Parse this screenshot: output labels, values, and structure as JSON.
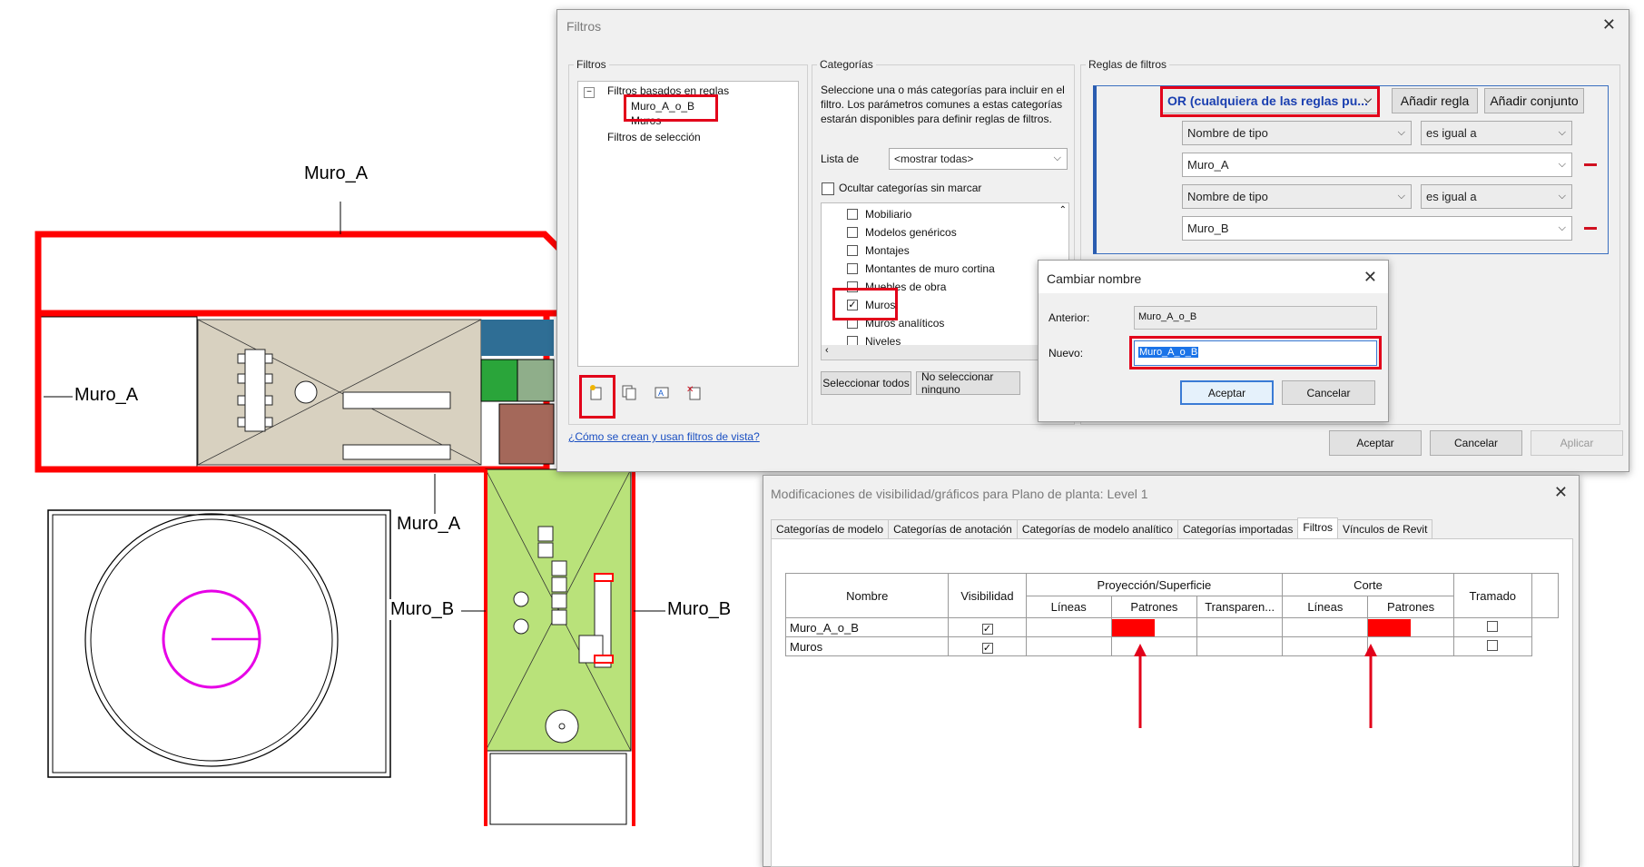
{
  "plan": {
    "labels": [
      "Muro_A",
      "Muro_A",
      "Muro_A",
      "Muro_B",
      "Muro_B"
    ]
  },
  "filtros_dialog": {
    "title": "Filtros",
    "filters_group": "Filtros",
    "tree_rules": "Filtros basados en reglas",
    "tree_item1": "Muro_A_o_B",
    "tree_item2": "Muros",
    "tree_selection": "Filtros de selección",
    "help_link": "¿Cómo se crean y usan filtros de vista?",
    "categories_group": "Categorías",
    "categories_desc": "Seleccione una o más categorías para incluir en el filtro. Los parámetros comunes a estas categorías estarán disponibles para definir reglas de filtros.",
    "list_label": "Lista de",
    "list_value": "<mostrar todas>",
    "hide_unchecked": "Ocultar categorías sin marcar",
    "categories": [
      {
        "name": "Mobiliario",
        "checked": false
      },
      {
        "name": "Modelos genéricos",
        "checked": false
      },
      {
        "name": "Montajes",
        "checked": false
      },
      {
        "name": "Montantes de muro cortina",
        "checked": false
      },
      {
        "name": "Muebles de obra",
        "checked": false
      },
      {
        "name": "Muros",
        "checked": true
      },
      {
        "name": "Muros analíticos",
        "checked": false
      },
      {
        "name": "Niveles",
        "checked": false
      }
    ],
    "select_all": "Seleccionar todos",
    "select_none": "No seleccionar ninguno",
    "rules_group": "Reglas de filtros",
    "rule_op": "OR (cualquiera de las reglas pu...",
    "add_rule": "Añadir regla",
    "add_set": "Añadir conjunto",
    "rules": [
      {
        "param": "Nombre de tipo",
        "cond": "es igual a",
        "value": "Muro_A"
      },
      {
        "param": "Nombre de tipo",
        "cond": "es igual a",
        "value": "Muro_B"
      }
    ],
    "ok": "Aceptar",
    "cancel": "Cancelar",
    "apply": "Aplicar"
  },
  "rename_dialog": {
    "title": "Cambiar nombre",
    "old_label": "Anterior:",
    "old_value": "Muro_A_o_B",
    "new_label": "Nuevo:",
    "new_value": "Muro_A_o_B",
    "ok": "Aceptar",
    "cancel": "Cancelar"
  },
  "vg_dialog": {
    "title": "Modificaciones de visibilidad/gráficos para Plano de planta: Level 1",
    "tabs": [
      "Categorías de modelo",
      "Categorías de anotación",
      "Categorías de modelo analítico",
      "Categorías importadas",
      "Filtros",
      "Vínculos de Revit"
    ],
    "active_tab": "Filtros",
    "headers": {
      "name": "Nombre",
      "visibility": "Visibilidad",
      "proj": "Proyección/Superficie",
      "cut": "Corte",
      "halftone": "Tramado",
      "lines": "Líneas",
      "patterns": "Patrones",
      "transparency": "Transparen..."
    },
    "rows": [
      {
        "name": "Muro_A_o_B",
        "visible": true,
        "proj_pattern_color": "#ff0000",
        "cut_pattern_color": "#ff0000"
      },
      {
        "name": "Muros",
        "visible": true
      }
    ]
  },
  "colors": {
    "highlight_red": "#e2001a",
    "wall_red": "#ff0000",
    "floor_green": "#b9e27a",
    "floor_tan": "#d8d1c0",
    "circle_magenta": "#e600e6"
  }
}
